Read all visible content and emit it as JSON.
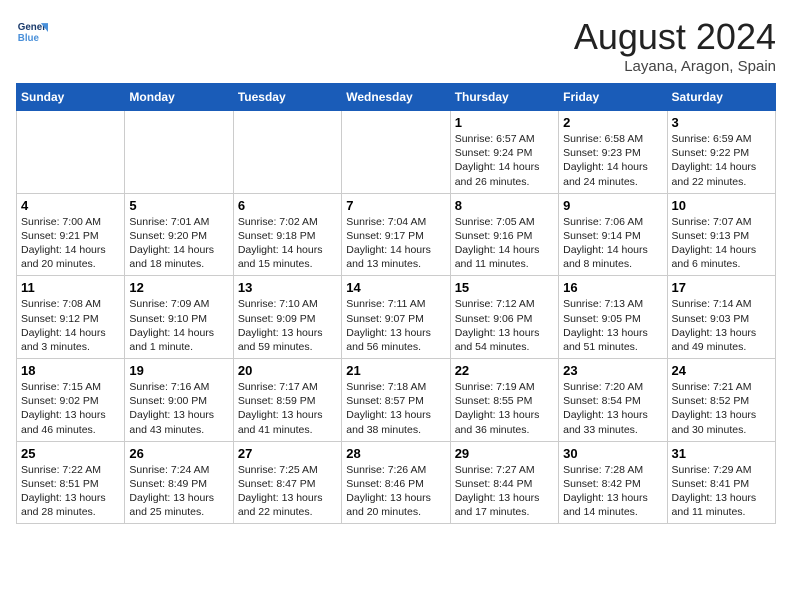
{
  "header": {
    "logo_line1": "General",
    "logo_line2": "Blue",
    "month": "August 2024",
    "location": "Layana, Aragon, Spain"
  },
  "days_of_week": [
    "Sunday",
    "Monday",
    "Tuesday",
    "Wednesday",
    "Thursday",
    "Friday",
    "Saturday"
  ],
  "weeks": [
    [
      {
        "day": "",
        "info": ""
      },
      {
        "day": "",
        "info": ""
      },
      {
        "day": "",
        "info": ""
      },
      {
        "day": "",
        "info": ""
      },
      {
        "day": "1",
        "info": "Sunrise: 6:57 AM\nSunset: 9:24 PM\nDaylight: 14 hours\nand 26 minutes."
      },
      {
        "day": "2",
        "info": "Sunrise: 6:58 AM\nSunset: 9:23 PM\nDaylight: 14 hours\nand 24 minutes."
      },
      {
        "day": "3",
        "info": "Sunrise: 6:59 AM\nSunset: 9:22 PM\nDaylight: 14 hours\nand 22 minutes."
      }
    ],
    [
      {
        "day": "4",
        "info": "Sunrise: 7:00 AM\nSunset: 9:21 PM\nDaylight: 14 hours\nand 20 minutes."
      },
      {
        "day": "5",
        "info": "Sunrise: 7:01 AM\nSunset: 9:20 PM\nDaylight: 14 hours\nand 18 minutes."
      },
      {
        "day": "6",
        "info": "Sunrise: 7:02 AM\nSunset: 9:18 PM\nDaylight: 14 hours\nand 15 minutes."
      },
      {
        "day": "7",
        "info": "Sunrise: 7:04 AM\nSunset: 9:17 PM\nDaylight: 14 hours\nand 13 minutes."
      },
      {
        "day": "8",
        "info": "Sunrise: 7:05 AM\nSunset: 9:16 PM\nDaylight: 14 hours\nand 11 minutes."
      },
      {
        "day": "9",
        "info": "Sunrise: 7:06 AM\nSunset: 9:14 PM\nDaylight: 14 hours\nand 8 minutes."
      },
      {
        "day": "10",
        "info": "Sunrise: 7:07 AM\nSunset: 9:13 PM\nDaylight: 14 hours\nand 6 minutes."
      }
    ],
    [
      {
        "day": "11",
        "info": "Sunrise: 7:08 AM\nSunset: 9:12 PM\nDaylight: 14 hours\nand 3 minutes."
      },
      {
        "day": "12",
        "info": "Sunrise: 7:09 AM\nSunset: 9:10 PM\nDaylight: 14 hours\nand 1 minute."
      },
      {
        "day": "13",
        "info": "Sunrise: 7:10 AM\nSunset: 9:09 PM\nDaylight: 13 hours\nand 59 minutes."
      },
      {
        "day": "14",
        "info": "Sunrise: 7:11 AM\nSunset: 9:07 PM\nDaylight: 13 hours\nand 56 minutes."
      },
      {
        "day": "15",
        "info": "Sunrise: 7:12 AM\nSunset: 9:06 PM\nDaylight: 13 hours\nand 54 minutes."
      },
      {
        "day": "16",
        "info": "Sunrise: 7:13 AM\nSunset: 9:05 PM\nDaylight: 13 hours\nand 51 minutes."
      },
      {
        "day": "17",
        "info": "Sunrise: 7:14 AM\nSunset: 9:03 PM\nDaylight: 13 hours\nand 49 minutes."
      }
    ],
    [
      {
        "day": "18",
        "info": "Sunrise: 7:15 AM\nSunset: 9:02 PM\nDaylight: 13 hours\nand 46 minutes."
      },
      {
        "day": "19",
        "info": "Sunrise: 7:16 AM\nSunset: 9:00 PM\nDaylight: 13 hours\nand 43 minutes."
      },
      {
        "day": "20",
        "info": "Sunrise: 7:17 AM\nSunset: 8:59 PM\nDaylight: 13 hours\nand 41 minutes."
      },
      {
        "day": "21",
        "info": "Sunrise: 7:18 AM\nSunset: 8:57 PM\nDaylight: 13 hours\nand 38 minutes."
      },
      {
        "day": "22",
        "info": "Sunrise: 7:19 AM\nSunset: 8:55 PM\nDaylight: 13 hours\nand 36 minutes."
      },
      {
        "day": "23",
        "info": "Sunrise: 7:20 AM\nSunset: 8:54 PM\nDaylight: 13 hours\nand 33 minutes."
      },
      {
        "day": "24",
        "info": "Sunrise: 7:21 AM\nSunset: 8:52 PM\nDaylight: 13 hours\nand 30 minutes."
      }
    ],
    [
      {
        "day": "25",
        "info": "Sunrise: 7:22 AM\nSunset: 8:51 PM\nDaylight: 13 hours\nand 28 minutes."
      },
      {
        "day": "26",
        "info": "Sunrise: 7:24 AM\nSunset: 8:49 PM\nDaylight: 13 hours\nand 25 minutes."
      },
      {
        "day": "27",
        "info": "Sunrise: 7:25 AM\nSunset: 8:47 PM\nDaylight: 13 hours\nand 22 minutes."
      },
      {
        "day": "28",
        "info": "Sunrise: 7:26 AM\nSunset: 8:46 PM\nDaylight: 13 hours\nand 20 minutes."
      },
      {
        "day": "29",
        "info": "Sunrise: 7:27 AM\nSunset: 8:44 PM\nDaylight: 13 hours\nand 17 minutes."
      },
      {
        "day": "30",
        "info": "Sunrise: 7:28 AM\nSunset: 8:42 PM\nDaylight: 13 hours\nand 14 minutes."
      },
      {
        "day": "31",
        "info": "Sunrise: 7:29 AM\nSunset: 8:41 PM\nDaylight: 13 hours\nand 11 minutes."
      }
    ]
  ]
}
